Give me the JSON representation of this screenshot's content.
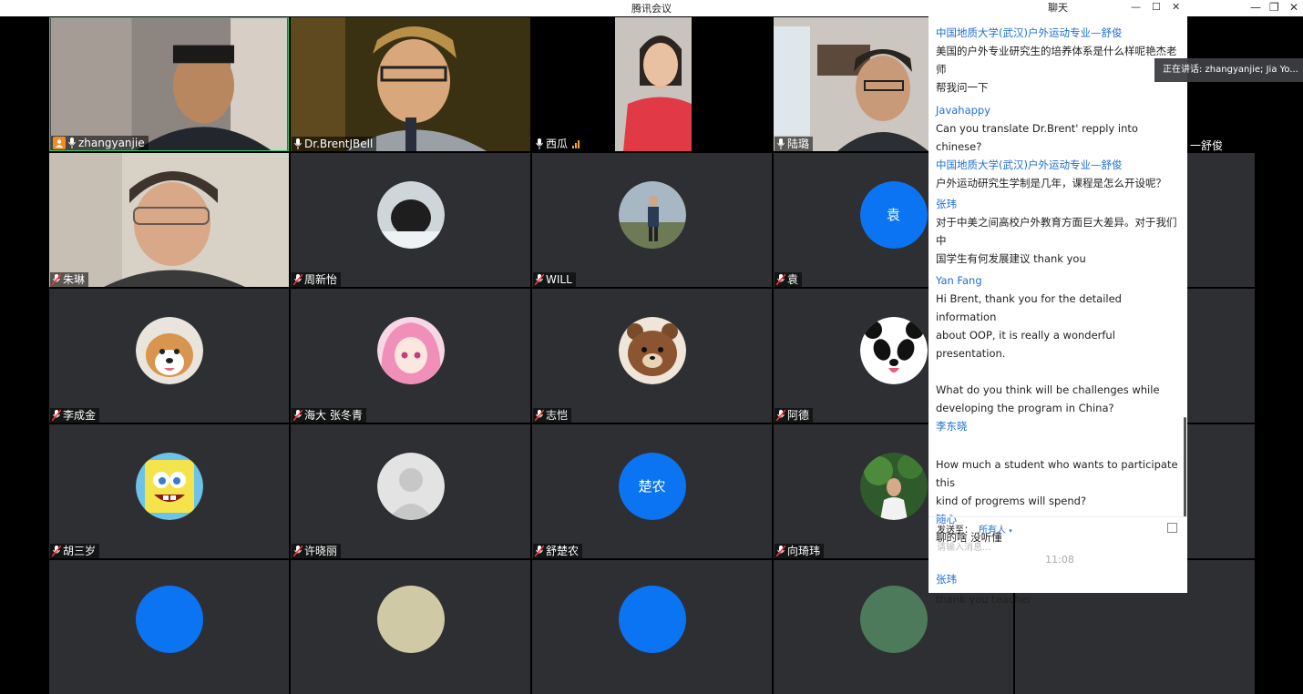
{
  "window": {
    "title": "腾讯会议"
  },
  "participants": [
    {
      "name": "zhangyanjie",
      "kind": "camera",
      "active": true,
      "host": true
    },
    {
      "name": "Dr.BrentJBell",
      "kind": "camera"
    },
    {
      "name": "西瓜",
      "kind": "camera",
      "signal": true
    },
    {
      "name": "陆璐",
      "kind": "camera"
    },
    {
      "name": "朱琳",
      "kind": "camera"
    },
    {
      "name": "周新怡",
      "kind": "photo",
      "icon": "dog-in-snow-avatar"
    },
    {
      "name": "WILL",
      "kind": "photo",
      "icon": "person-outdoors-avatar"
    },
    {
      "name": "袁",
      "kind": "text",
      "avatar_text": "袁"
    },
    {
      "name": "李成金",
      "kind": "photo",
      "icon": "shiba-dog-avatar"
    },
    {
      "name": "海大 张冬青",
      "kind": "photo",
      "icon": "anime-girl-avatar"
    },
    {
      "name": "志恺",
      "kind": "photo",
      "icon": "bear-avatar"
    },
    {
      "name": "阿德",
      "kind": "photo",
      "icon": "panda-avatar"
    },
    {
      "name": "胡三岁",
      "kind": "photo",
      "icon": "spongebob-avatar"
    },
    {
      "name": "许晓丽",
      "kind": "photo",
      "icon": "default-person-avatar"
    },
    {
      "name": "舒楚农",
      "kind": "text",
      "avatar_text": "楚农"
    },
    {
      "name": "向琦玮",
      "kind": "photo",
      "icon": "person-with-tree-avatar"
    }
  ],
  "chat": {
    "title": "聊天",
    "messages": [
      {
        "sender": "中国地质大学(武汉)户外运动专业—舒俊",
        "lines": [
          "美国的户外专业研究生的培养体系是什么样呢艳杰老师",
          "帮我问一下"
        ]
      },
      {
        "sender": "Javahappy",
        "lines": [
          "Can you translate Dr.Brent' repply into chinese?"
        ]
      },
      {
        "sender": "中国地质大学(武汉)户外运动专业—舒俊",
        "lines": [
          "户外运动研究生学制是几年，课程是怎么开设呢？"
        ]
      },
      {
        "sender": "张玮",
        "lines": [
          "对于中美之间高校户外教育方面巨大差异。对于我们中",
          "国学生有何发展建议 thank you"
        ]
      },
      {
        "sender": "Yan Fang",
        "lines": [
          "Hi Brent, thank you for the detailed information",
          "about OOP, it is really a wonderful presentation.",
          "",
          "What do you think will be challenges while",
          "developing the program in China?"
        ]
      },
      {
        "sender": "李东晓",
        "lines": [
          "",
          "How much a student who wants to participate this",
          "kind of progrems will spend?"
        ]
      },
      {
        "sender": "随心",
        "lines": [
          "聊的啥 没听懂"
        ]
      }
    ],
    "time_separator": "11:08",
    "last_message": {
      "sender": "张玮",
      "lines": [
        "thank you teacher"
      ]
    },
    "send_to_label": "发送至：",
    "send_to_value": "所有人",
    "input_placeholder": "请输入消息..."
  },
  "speaking_banner": "正在讲话: zhangyanjie; Jia Yo...",
  "stray_label": "一舒俊",
  "colors": {
    "accent": "#1e6fd9",
    "tile_bg": "#2e2f32",
    "text_avatar_bg": "#0b74f2",
    "active_border": "#2ecc71"
  }
}
